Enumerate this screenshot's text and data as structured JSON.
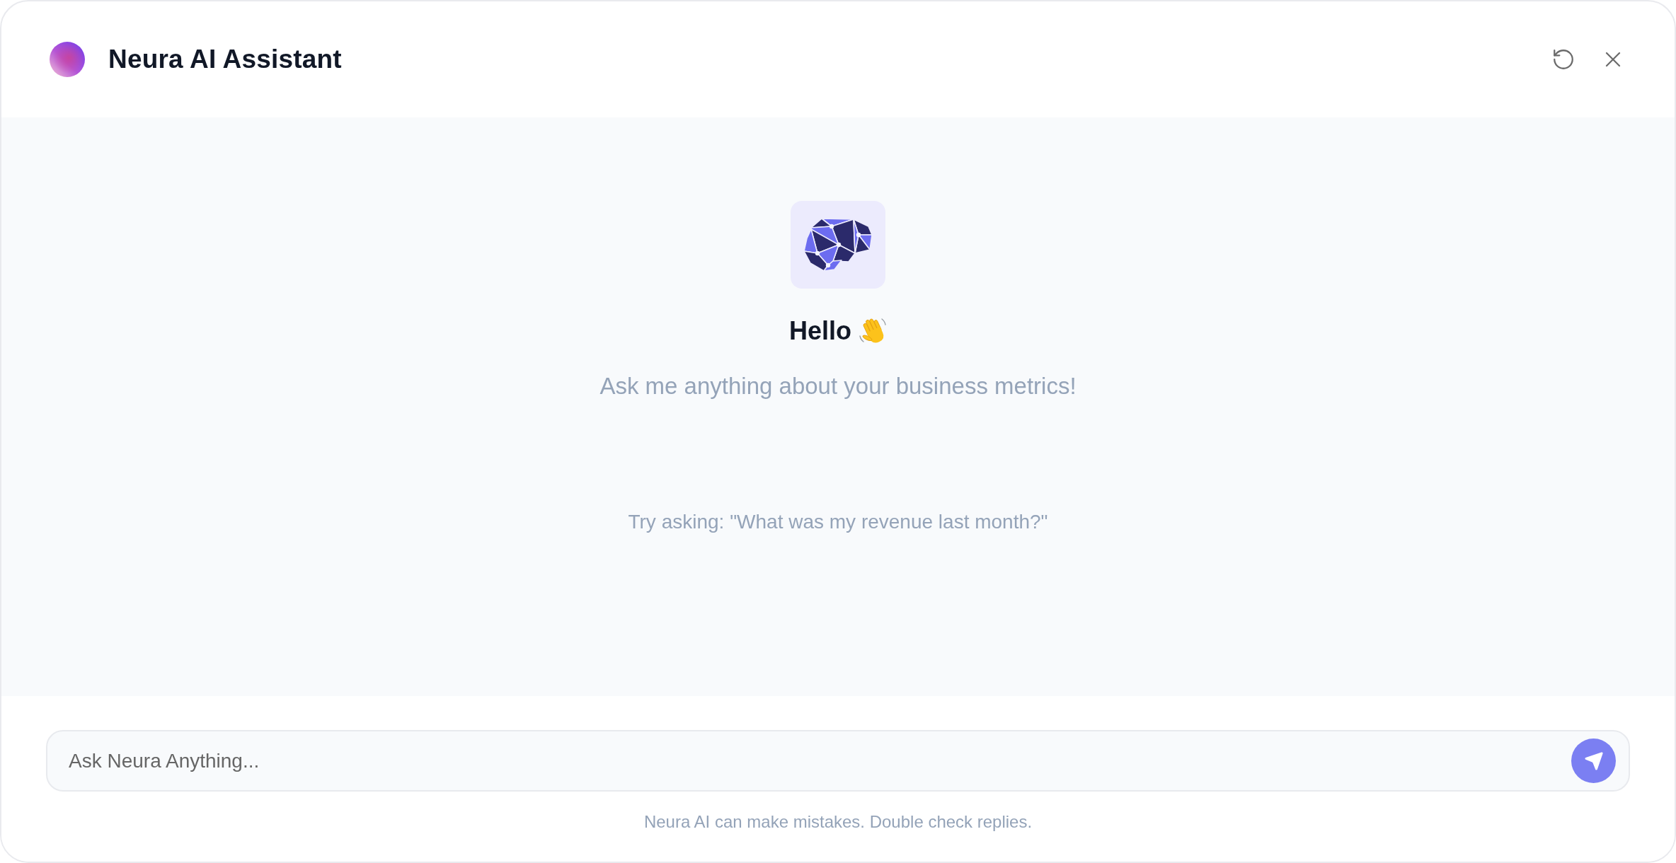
{
  "window": {
    "title": "Neura AI Assistant"
  },
  "welcome": {
    "greeting": "Hello",
    "subtitle": "Ask me anything about your business metrics!",
    "suggestion": "Try asking: \"What was my revenue last month?\""
  },
  "composer": {
    "placeholder": "Ask Neura Anything..."
  },
  "disclaimer": "Neura AI can make mistakes. Double check replies."
}
